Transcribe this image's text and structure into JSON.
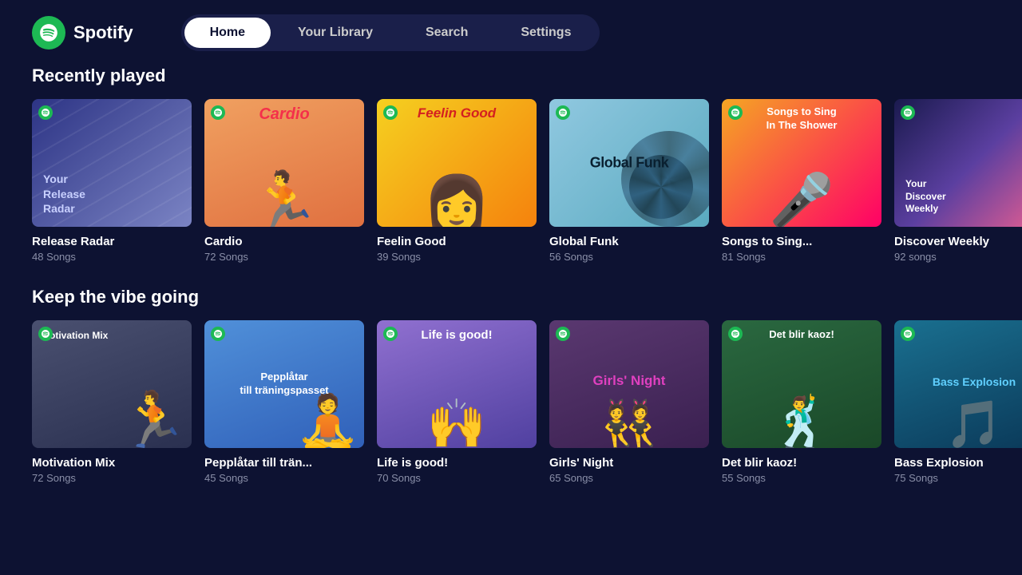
{
  "app": {
    "name": "Spotify",
    "logo_alt": "Spotify Logo"
  },
  "nav": {
    "tabs": [
      {
        "id": "home",
        "label": "Home",
        "active": true
      },
      {
        "id": "library",
        "label": "Your Library",
        "active": false
      },
      {
        "id": "search",
        "label": "Search",
        "active": false
      },
      {
        "id": "settings",
        "label": "Settings",
        "active": false
      }
    ]
  },
  "recently_played": {
    "section_title": "Recently played",
    "playlists": [
      {
        "id": "release-radar",
        "name": "Release Radar",
        "count": "48 Songs",
        "thumb_type": "release-radar",
        "thumb_label": "Your\nRelease\nRadar"
      },
      {
        "id": "cardio",
        "name": "Cardio",
        "count": "72 Songs",
        "thumb_type": "cardio",
        "thumb_label": "Cardio"
      },
      {
        "id": "feelin-good",
        "name": "Feelin Good",
        "count": "39 Songs",
        "thumb_type": "feelin-good",
        "thumb_label": "Feelin Good"
      },
      {
        "id": "global-funk",
        "name": "Global Funk",
        "count": "56 Songs",
        "thumb_type": "global-funk",
        "thumb_label": "Global Funk"
      },
      {
        "id": "songs-shower",
        "name": "Songs to Sing...",
        "count": "81 Songs",
        "thumb_type": "songs-shower",
        "thumb_label": "Songs to Sing\nIn The Shower"
      },
      {
        "id": "discover-weekly",
        "name": "Discover Weekly",
        "count": "92 songs",
        "thumb_type": "discover-weekly",
        "thumb_label": "Your\nDiscover\nWeekly"
      }
    ]
  },
  "keep_vibe": {
    "section_title": "Keep the vibe going",
    "playlists": [
      {
        "id": "motivation-mix",
        "name": "Motivation Mix",
        "count": "72 Songs",
        "thumb_type": "motivation-mix",
        "thumb_label": "Motivation Mix"
      },
      {
        "id": "pepplatar",
        "name": "Pepplåtar till trän...",
        "count": "45 Songs",
        "thumb_type": "pepplatar",
        "thumb_label": "Pepplåtar\ntill träningspasset"
      },
      {
        "id": "life-good",
        "name": "Life is good!",
        "count": "70 Songs",
        "thumb_type": "life-good",
        "thumb_label": "Life is good!"
      },
      {
        "id": "girls-night",
        "name": "Girls' Night",
        "count": "65 Songs",
        "thumb_type": "girls-night",
        "thumb_label": "Girls' Night"
      },
      {
        "id": "det-kaoz",
        "name": "Det blir kaoz!",
        "count": "55 Songs",
        "thumb_type": "det-kaoz",
        "thumb_label": "Det blir kaoz!"
      },
      {
        "id": "bass-explosion",
        "name": "Bass Explosion",
        "count": "75 Songs",
        "thumb_type": "bass-explosion",
        "thumb_label": "Bass Explosion"
      }
    ]
  }
}
